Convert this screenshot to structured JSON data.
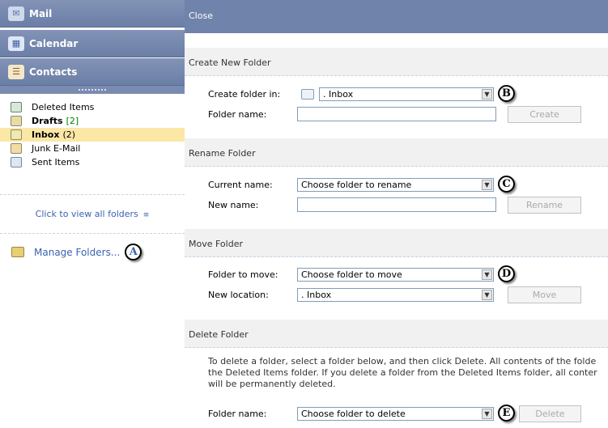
{
  "nav": {
    "mail": "Mail",
    "calendar": "Calendar",
    "contacts": "Contacts"
  },
  "folders": [
    {
      "name": "Deleted Items",
      "bold": false,
      "count": ""
    },
    {
      "name": "Drafts",
      "bold": true,
      "count": "[2]"
    },
    {
      "name": "Inbox",
      "bold": true,
      "count": "(2)"
    },
    {
      "name": "Junk E-Mail",
      "bold": false,
      "count": ""
    },
    {
      "name": "Sent Items",
      "bold": false,
      "count": ""
    }
  ],
  "view_all": "Click to view all folders",
  "manage": "Manage Folders...",
  "callouts": {
    "a": "A",
    "b": "B",
    "c": "C",
    "d": "D",
    "e": "E"
  },
  "header": {
    "close": "Close"
  },
  "create": {
    "title": "Create New Folder",
    "in_label": "Create folder in:",
    "in_value": ". Inbox",
    "name_label": "Folder name:",
    "button": "Create"
  },
  "rename": {
    "title": "Rename Folder",
    "current_label": "Current name:",
    "current_value": "Choose folder to rename",
    "new_label": "New name:",
    "button": "Rename"
  },
  "move": {
    "title": "Move Folder",
    "folder_label": "Folder to move:",
    "folder_value": "Choose folder to move",
    "location_label": "New location:",
    "location_value": ". Inbox",
    "button": "Move"
  },
  "delete": {
    "title": "Delete Folder",
    "info_1": "To delete a folder, select a folder below, and then click Delete. All contents of the folde",
    "info_2": "the Deleted Items folder. If you delete a folder from the Deleted Items folder, all conter",
    "info_3": "will be permanently deleted.",
    "name_label": "Folder name:",
    "name_value": "Choose folder to delete",
    "button": "Delete"
  }
}
